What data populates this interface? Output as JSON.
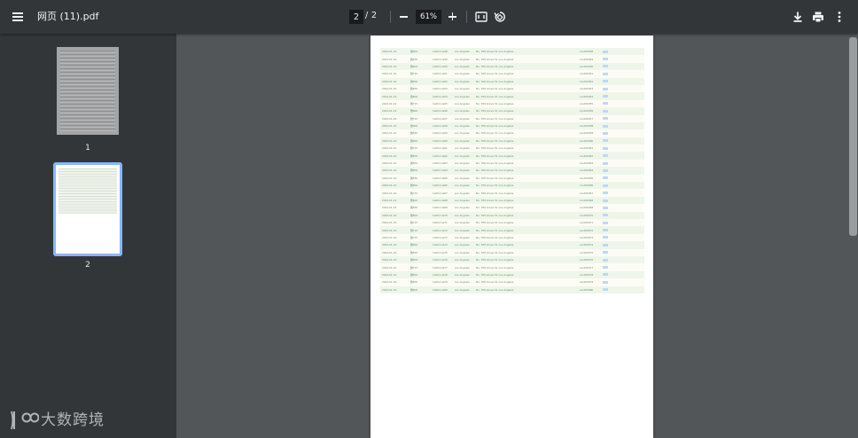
{
  "toolbar": {
    "title": "网页 (11).pdf",
    "current_page": "2",
    "page_separator": "/",
    "total_pages": "2",
    "zoom": "61%",
    "icons": [
      "menu-icon",
      "minus-icon",
      "plus-icon",
      "fit-page-icon",
      "rotate-icon",
      "download-icon",
      "print-icon",
      "more-vert-icon"
    ]
  },
  "sidebar": {
    "thumbnails": [
      {
        "label": "1",
        "selected": false
      },
      {
        "label": "2",
        "selected": true
      }
    ],
    "selected_color": "#8ab4f8"
  },
  "document": {
    "rows": [
      [
        "2024-01-19",
        "雅802",
        "California48",
        "Los Angeles",
        "No. 789 Grove St, Los Angeles",
        "LA-000048"
      ],
      [
        "2024-01-19",
        "雅830",
        "California49",
        "Los Angeles",
        "No. 789 Grove St, Los Angeles",
        "LA-000049"
      ],
      [
        "2024-01-19",
        "雅804",
        "California50",
        "Los Angeles",
        "No. 789 Grove St, Los Angeles",
        "LA-000050"
      ],
      [
        "2024-01-19",
        "雅715",
        "California51",
        "Los Angeles",
        "No. 789 Grove St, Los Angeles",
        "LA-000051"
      ],
      [
        "2024-01-19",
        "雅802",
        "California52",
        "Los Angeles",
        "No. 789 Grove St, Los Angeles",
        "LA-000052"
      ],
      [
        "2024-01-19",
        "雅830",
        "California53",
        "Los Angeles",
        "No. 789 Grove St, Los Angeles",
        "LA-000053"
      ],
      [
        "2024-01-19",
        "雅804",
        "California54",
        "Los Angeles",
        "No. 789 Grove St, Los Angeles",
        "LA-000054"
      ],
      [
        "2024-01-19",
        "雅715",
        "California55",
        "Los Angeles",
        "No. 789 Grove St, Los Angeles",
        "LA-000055"
      ],
      [
        "2024-01-19",
        "雅802",
        "California56",
        "Los Angeles",
        "No. 789 Grove St, Los Angeles",
        "LA-000056"
      ],
      [
        "2024-01-19",
        "雅715",
        "California57",
        "Los Angeles",
        "No. 789 Grove St, Los Angeles",
        "LA-000057"
      ],
      [
        "2024-01-19",
        "雅802",
        "California58",
        "Los Angeles",
        "No. 789 Grove St, Los Angeles",
        "LA-000058"
      ],
      [
        "2024-01-19",
        "雅830",
        "California59",
        "Los Angeles",
        "No. 789 Grove St, Los Angeles",
        "LA-000059"
      ],
      [
        "2024-01-19",
        "雅802",
        "California60",
        "Los Angeles",
        "No. 789 Grove St, Los Angeles",
        "LA-000060"
      ],
      [
        "2024-01-19",
        "雅715",
        "California61",
        "Los Angeles",
        "No. 789 Grove St, Los Angeles",
        "LA-000061"
      ],
      [
        "2024-01-19",
        "雅830",
        "California62",
        "Los Angeles",
        "No. 789 Grove St, Los Angeles",
        "LA-000062"
      ],
      [
        "2024-01-19",
        "雅804",
        "California63",
        "Los Angeles",
        "No. 789 Grove St, Los Angeles",
        "LA-000063"
      ],
      [
        "2024-01-19",
        "雅802",
        "California64",
        "Los Angeles",
        "No. 789 Grove St, Los Angeles",
        "LA-000064"
      ],
      [
        "2024-01-19",
        "雅830",
        "California65",
        "Los Angeles",
        "No. 789 Grove St, Los Angeles",
        "LA-000065"
      ],
      [
        "2024-01-19",
        "雅804",
        "California66",
        "Los Angeles",
        "No. 789 Grove St, Los Angeles",
        "LA-000066"
      ],
      [
        "2024-01-19",
        "雅715",
        "California67",
        "Los Angeles",
        "No. 789 Grove St, Los Angeles",
        "LA-000067"
      ],
      [
        "2024-01-19",
        "雅802",
        "California68",
        "Los Angeles",
        "No. 789 Grove St, Los Angeles",
        "LA-000068"
      ],
      [
        "2024-01-19",
        "雅830",
        "California69",
        "Los Angeles",
        "No. 789 Grove St, Los Angeles",
        "LA-000069"
      ],
      [
        "2024-01-19",
        "雅804",
        "California70",
        "Los Angeles",
        "No. 789 Grove St, Los Angeles",
        "LA-000070"
      ],
      [
        "2024-01-19",
        "雅715",
        "California71",
        "Los Angeles",
        "No. 789 Grove St, Los Angeles",
        "LA-000071"
      ],
      [
        "2024-01-19",
        "雅715",
        "California72",
        "Los Angeles",
        "No. 789 Grove St, Los Angeles",
        "LA-000072"
      ],
      [
        "2024-01-19",
        "雅715",
        "California73",
        "Los Angeles",
        "No. 789 Grove St, Los Angeles",
        "LA-000073"
      ],
      [
        "2024-01-19",
        "雅802",
        "California74",
        "Los Angeles",
        "No. 789 Grove St, Los Angeles",
        "LA-000074"
      ],
      [
        "2024-01-19",
        "雅830",
        "California75",
        "Los Angeles",
        "No. 789 Grove St, Los Angeles",
        "LA-000075"
      ],
      [
        "2024-01-19",
        "雅804",
        "California76",
        "Los Angeles",
        "No. 789 Grove St, Los Angeles",
        "LA-000076"
      ],
      [
        "2024-01-19",
        "雅715",
        "California77",
        "Los Angeles",
        "No. 789 Grove St, Los Angeles",
        "LA-000077"
      ],
      [
        "2024-01-19",
        "雅802",
        "California78",
        "Los Angeles",
        "No. 789 Grove St, Los Angeles",
        "LA-000078"
      ],
      [
        "2024-01-19",
        "雅830",
        "California79",
        "Los Angeles",
        "No. 789 Grove St, Los Angeles",
        "LA-000079"
      ],
      [
        "2024-01-19",
        "雅804",
        "California80",
        "Los Angeles",
        "No. 789 Grove St, Los Angeles",
        "LA-000080"
      ]
    ],
    "row_colors": {
      "odd": "#eef6ea",
      "even": "#fdfcf4",
      "text": "#6b8f6b",
      "tag": "#bcd9f2"
    }
  },
  "watermark": {
    "logo_text": "DO",
    "text": "大数跨境"
  },
  "colors": {
    "toolbar_bg": "#323639",
    "viewer_bg": "#525659",
    "accent": "#8ab4f8"
  }
}
